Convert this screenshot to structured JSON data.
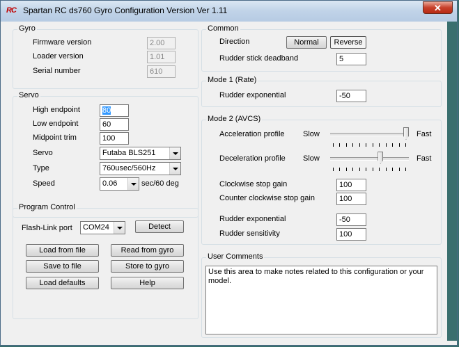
{
  "window": {
    "title": "Spartan RC ds760 Gyro Configuration Version Ver 1.11",
    "icon_text": "RC",
    "close_label": "✕"
  },
  "gyro": {
    "title": "Gyro",
    "firmware_label": "Firmware version",
    "firmware_value": "2.00",
    "loader_label": "Loader version",
    "loader_value": "1.01",
    "serial_label": "Serial number",
    "serial_value": "610"
  },
  "servo": {
    "title": "Servo",
    "high_label": "High endpoint",
    "high_value": "80",
    "low_label": "Low endpoint",
    "low_value": "60",
    "mid_label": "Midpoint trim",
    "mid_value": "100",
    "servo_label": "Servo",
    "servo_value": "Futaba BLS251",
    "type_label": "Type",
    "type_value": "760usec/560Hz",
    "speed_label": "Speed",
    "speed_value": "0.06",
    "speed_unit": "sec/60 deg"
  },
  "program": {
    "title": "Program Control",
    "port_label": "Flash-Link port",
    "port_value": "COM24",
    "detect_label": "Detect",
    "load_file": "Load from file",
    "read_gyro": "Read from gyro",
    "save_file": "Save to file",
    "store_gyro": "Store to gyro",
    "load_defaults": "Load defaults",
    "help": "Help"
  },
  "common": {
    "title": "Common",
    "direction_label": "Direction",
    "normal_label": "Normal",
    "reverse_label": "Reverse",
    "deadband_label": "Rudder stick deadband",
    "deadband_value": "5"
  },
  "mode1": {
    "title": "Mode 1 (Rate)",
    "expo_label": "Rudder exponential",
    "expo_value": "-50"
  },
  "mode2": {
    "title": "Mode 2 (AVCS)",
    "accel_label": "Acceleration profile",
    "accel_level": 1.0,
    "decel_label": "Deceleration profile",
    "decel_level": 0.65,
    "slow_label": "Slow",
    "fast_label": "Fast",
    "cw_label": "Clockwise stop gain",
    "cw_value": "100",
    "ccw_label": "Counter clockwise stop gain",
    "ccw_value": "100",
    "expo_label": "Rudder exponential",
    "expo_value": "-50",
    "sens_label": "Rudder sensitivity",
    "sens_value": "100"
  },
  "comments": {
    "title": "User Comments",
    "text": "Use this area to make notes related to this configuration or your model."
  }
}
